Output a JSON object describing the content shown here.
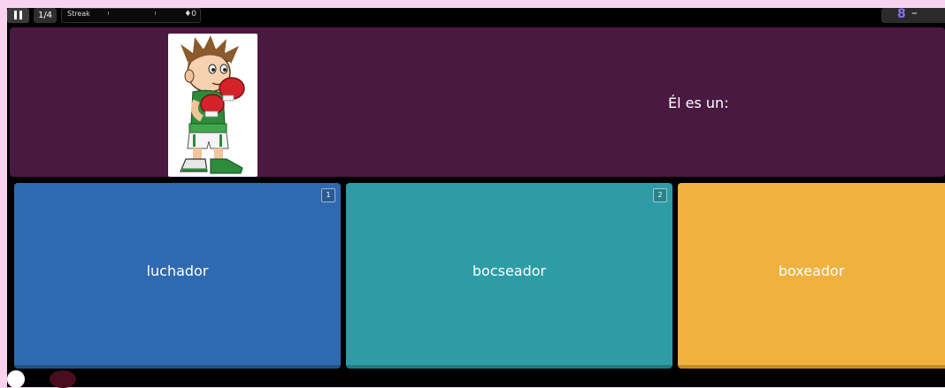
{
  "topbar": {
    "question_counter": "1/4",
    "streak_label": "Streak",
    "streak_value": "0",
    "score": "8",
    "score_suffix": "–"
  },
  "question": {
    "text": "Él es un:",
    "image_icon": "boxer-cartoon"
  },
  "answers": [
    {
      "label": "luchador",
      "number": "1",
      "color": "#2f6ab0"
    },
    {
      "label": "bocseador",
      "number": "2",
      "color": "#2d9ca5"
    },
    {
      "label": "boxeador",
      "color": "#efb23f"
    }
  ],
  "colors": {
    "page_background": "#f7d3f0",
    "question_panel": "#4a1942",
    "score_accent": "#8a6cf7"
  }
}
